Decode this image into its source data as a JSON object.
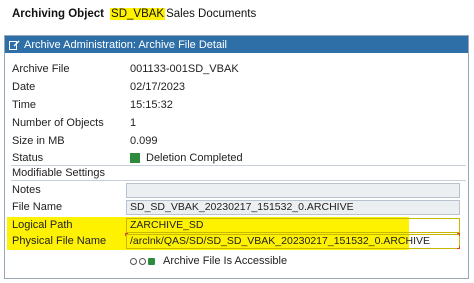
{
  "archiving_object": {
    "label": "Archiving Object",
    "code": "SD_VBAK",
    "description": "Sales Documents"
  },
  "panel": {
    "title": "Archive Administration: Archive File Detail",
    "icon": "edit-doc-icon"
  },
  "details": {
    "archive_file": {
      "label": "Archive File",
      "value": "001133-001SD_VBAK"
    },
    "date": {
      "label": "Date",
      "value": "02/17/2023"
    },
    "time": {
      "label": "Time",
      "value": "15:15:32"
    },
    "number_of_objects": {
      "label": "Number of Objects",
      "value": "1"
    },
    "size_in_mb": {
      "label": "Size in MB",
      "value": "0.099"
    },
    "status": {
      "label": "Status",
      "value": "Deletion Completed",
      "color": "#2e8b3e"
    }
  },
  "modifiable": {
    "section_title": "Modifiable Settings",
    "notes": {
      "label": "Notes",
      "value": ""
    },
    "file_name": {
      "label": "File Name",
      "value": "SD_SD_VBAK_20230217_151532_0.ARCHIVE"
    },
    "logical_path": {
      "label": "Logical Path",
      "value": "ZARCHIVE_SD"
    },
    "physical_file_name": {
      "label": "Physical File Name",
      "value": "/arclnk/QAS/SD/SD_SD_VBAK_20230217_151532_0.ARCHIVE"
    }
  },
  "accessibility": {
    "text": "Archive File Is Accessible",
    "indicator": "traffic-light-green-icon"
  },
  "colors": {
    "header_bg": "#2f6fa7",
    "highlight": "#fff200",
    "status_green": "#2e8b3e"
  }
}
